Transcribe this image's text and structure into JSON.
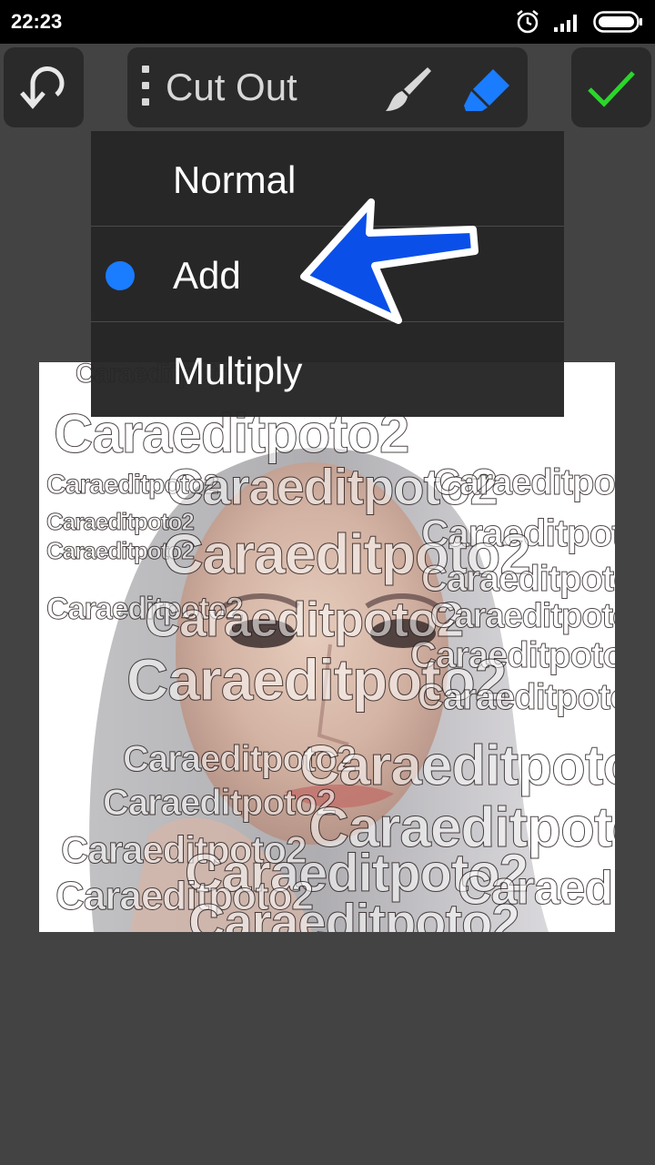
{
  "status_bar": {
    "time": "22:23"
  },
  "toolbar": {
    "mode_label": "Cut Out",
    "brush_icon": "brush-icon",
    "eraser_icon": "eraser-icon",
    "undo_icon": "undo-icon",
    "confirm_icon": "check-icon"
  },
  "dropdown": {
    "items": [
      {
        "label": "Normal",
        "selected": false
      },
      {
        "label": "Add",
        "selected": true
      },
      {
        "label": "Multiply",
        "selected": false
      }
    ]
  },
  "photo": {
    "watermark_text": "Caraeditpoto2"
  },
  "colors": {
    "accent_blue": "#1a7cff",
    "check_green": "#2bd62b",
    "background": "#434343",
    "toolbar_bg": "#2a2a2a"
  }
}
